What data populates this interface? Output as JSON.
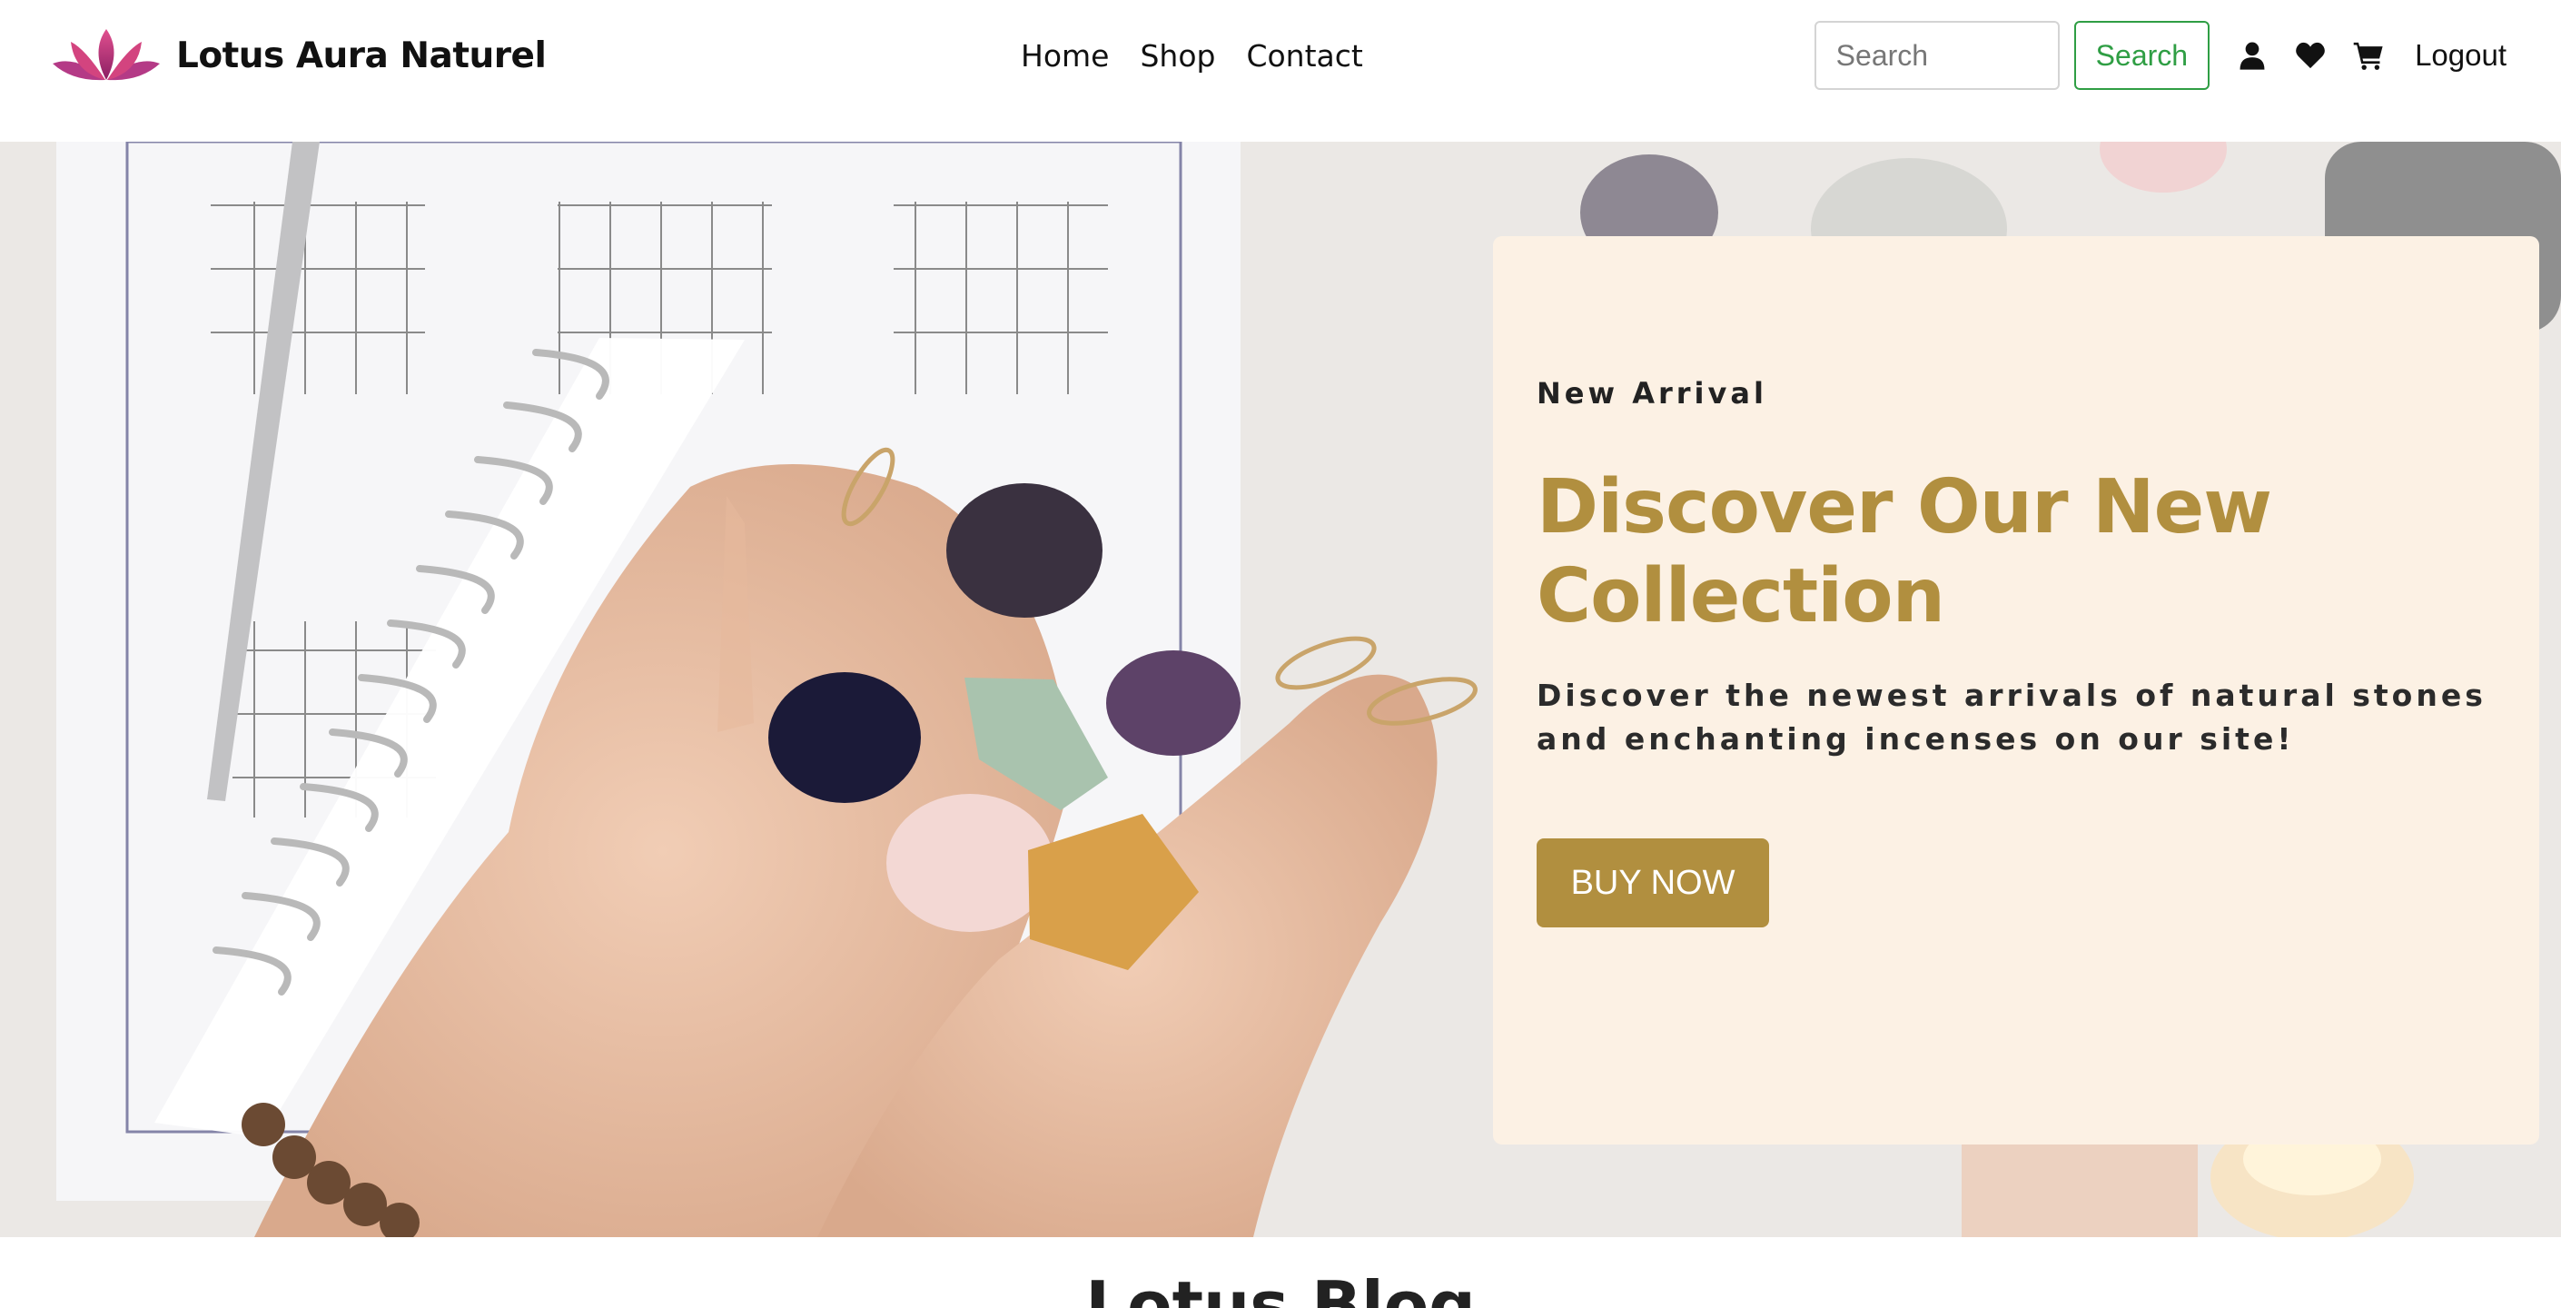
{
  "navbar": {
    "brand_name": "Lotus Aura Naturel",
    "links": [
      {
        "label": "Home"
      },
      {
        "label": "Shop"
      },
      {
        "label": "Contact"
      }
    ],
    "search": {
      "placeholder": "Search",
      "value": ""
    },
    "search_button": "Search",
    "icons": [
      "user-icon",
      "heart-icon",
      "cart-icon"
    ],
    "logout_label": "Logout"
  },
  "hero": {
    "eyebrow": "New Arrival",
    "title": "Discover Our New Collection",
    "description": "Discover the newest arrivals of natural stones and enchanting incenses on our site!",
    "cta_label": "BUY NOW"
  },
  "blog": {
    "title": "Lotus Blog"
  },
  "colors": {
    "accent_gold": "#b18f3f",
    "card_background": "#fcf1e4",
    "search_green": "#2f9e44",
    "logo_pink": "#c2306f"
  }
}
